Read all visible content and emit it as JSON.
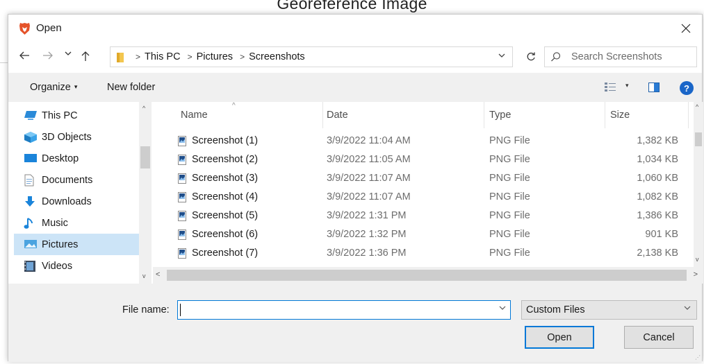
{
  "background": {
    "title": "Georeference Image"
  },
  "dialog": {
    "title": "Open",
    "close_glyph": "✕",
    "address": {
      "crumbs": [
        "This PC",
        "Pictures",
        "Screenshots"
      ]
    },
    "search": {
      "placeholder": "Search Screenshots"
    },
    "toolbar": {
      "organize_label": "Organize",
      "new_folder_label": "New folder",
      "help_glyph": "?"
    },
    "nav_pane": {
      "items": [
        {
          "label": "This PC",
          "icon": "computer-icon"
        },
        {
          "label": "3D Objects",
          "icon": "3d-objects-icon"
        },
        {
          "label": "Desktop",
          "icon": "desktop-icon"
        },
        {
          "label": "Documents",
          "icon": "documents-icon"
        },
        {
          "label": "Downloads",
          "icon": "downloads-icon"
        },
        {
          "label": "Music",
          "icon": "music-icon"
        },
        {
          "label": "Pictures",
          "icon": "pictures-icon",
          "selected": true
        },
        {
          "label": "Videos",
          "icon": "videos-icon"
        }
      ]
    },
    "file_list": {
      "columns": {
        "name": "Name",
        "date": "Date",
        "type": "Type",
        "size": "Size"
      },
      "rows": [
        {
          "name": "Screenshot (1)",
          "date": "3/9/2022 11:04 AM",
          "type": "PNG File",
          "size": "1,382 KB"
        },
        {
          "name": "Screenshot (2)",
          "date": "3/9/2022 11:05 AM",
          "type": "PNG File",
          "size": "1,034 KB"
        },
        {
          "name": "Screenshot (3)",
          "date": "3/9/2022 11:07 AM",
          "type": "PNG File",
          "size": "1,060 KB"
        },
        {
          "name": "Screenshot (4)",
          "date": "3/9/2022 11:07 AM",
          "type": "PNG File",
          "size": "1,082 KB"
        },
        {
          "name": "Screenshot (5)",
          "date": "3/9/2022 1:31 PM",
          "type": "PNG File",
          "size": "1,386 KB"
        },
        {
          "name": "Screenshot (6)",
          "date": "3/9/2022 1:32 PM",
          "type": "PNG File",
          "size": "901 KB"
        },
        {
          "name": "Screenshot (7)",
          "date": "3/9/2022 1:36 PM",
          "type": "PNG File",
          "size": "2,138 KB"
        }
      ]
    },
    "footer": {
      "file_name_label": "File name:",
      "file_name_value": "",
      "file_type_value": "Custom Files",
      "open_label": "Open",
      "cancel_label": "Cancel"
    },
    "colors": {
      "accent": "#0078d7",
      "selection": "#cce4f7",
      "help": "#1a66c8",
      "app_icon": "#e5532a"
    }
  }
}
